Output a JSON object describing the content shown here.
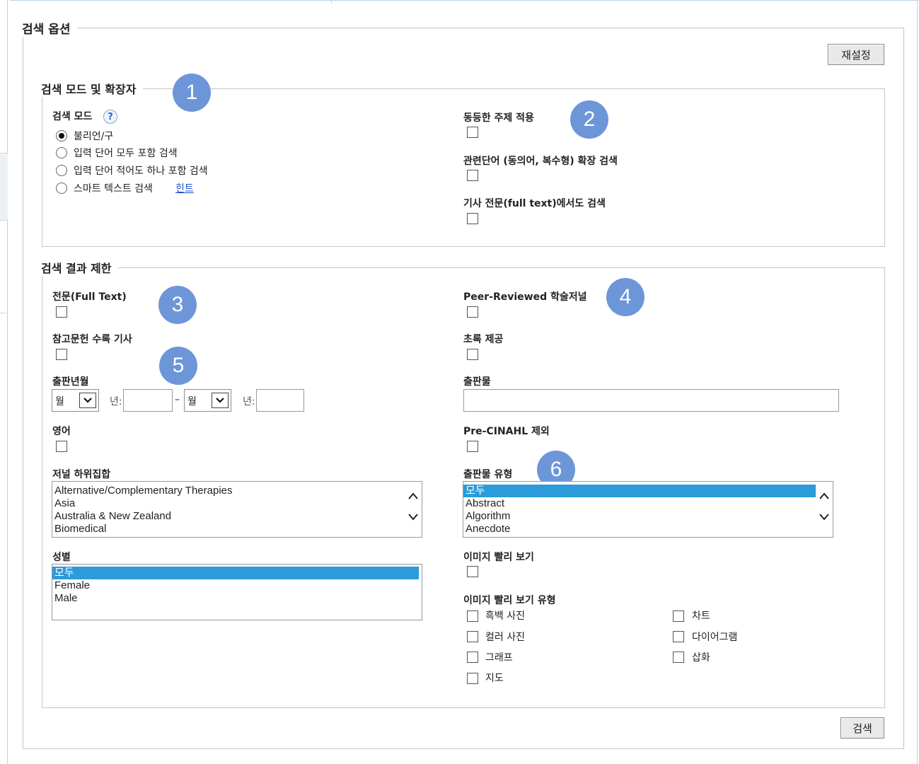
{
  "sections": {
    "search_options": "검색 옵션",
    "mode_expanders": "검색 모드 및 확장자",
    "limit_results": "검색 결과 제한"
  },
  "buttons": {
    "reset": "재설정",
    "search": "검색"
  },
  "badges": [
    "1",
    "2",
    "3",
    "4",
    "5",
    "6"
  ],
  "search_mode": {
    "label": "검색 모드",
    "help": "?",
    "options": [
      "불리언/구",
      "입력 단어 모두 포함 검색",
      "입력 단어 적어도 하나 포함 검색",
      "스마트 텍스트 검색"
    ],
    "selected_index": 0,
    "hint_link": "힌트"
  },
  "expanders": {
    "equivalent_subjects": "동등한 주제 적용",
    "related_words": "관련단어 (동의어, 복수형) 확장 검색",
    "full_text_search": "기사 전문(full text)에서도 검색"
  },
  "limits": {
    "full_text": "전문(Full Text)",
    "peer_reviewed": "Peer-Reviewed 학술저널",
    "references_available": "참고문헌 수록 기사",
    "abstract_available": "초록 제공",
    "published_date": {
      "label": "출판년월",
      "month_from": "월",
      "year_label": "년:",
      "dash": "–",
      "month_to": "월",
      "year_label2": "년:"
    },
    "publication": "출판물",
    "english": "영어",
    "pre_cinahl": "Pre-CINAHL 제외",
    "journal_subset": {
      "label": "저널 하위집합",
      "options": [
        "Alternative/Complementary Therapies",
        "Asia",
        "Australia & New Zealand",
        "Biomedical"
      ]
    },
    "publication_type": {
      "label": "출판물 유형",
      "options": [
        "모두",
        "Abstract",
        "Algorithm",
        "Anecdote"
      ],
      "selected": "모두"
    },
    "gender": {
      "label": "성별",
      "options": [
        "모두",
        "Female",
        "Male"
      ],
      "selected": "모두"
    },
    "image_quick_view": "이미지 빨리 보기",
    "image_quick_view_types": {
      "label": "이미지 빨리 보기 유형",
      "options": [
        "흑백 사진",
        "차트",
        "컬러 사진",
        "다이어그램",
        "그래프",
        "삽화",
        "지도"
      ]
    }
  }
}
